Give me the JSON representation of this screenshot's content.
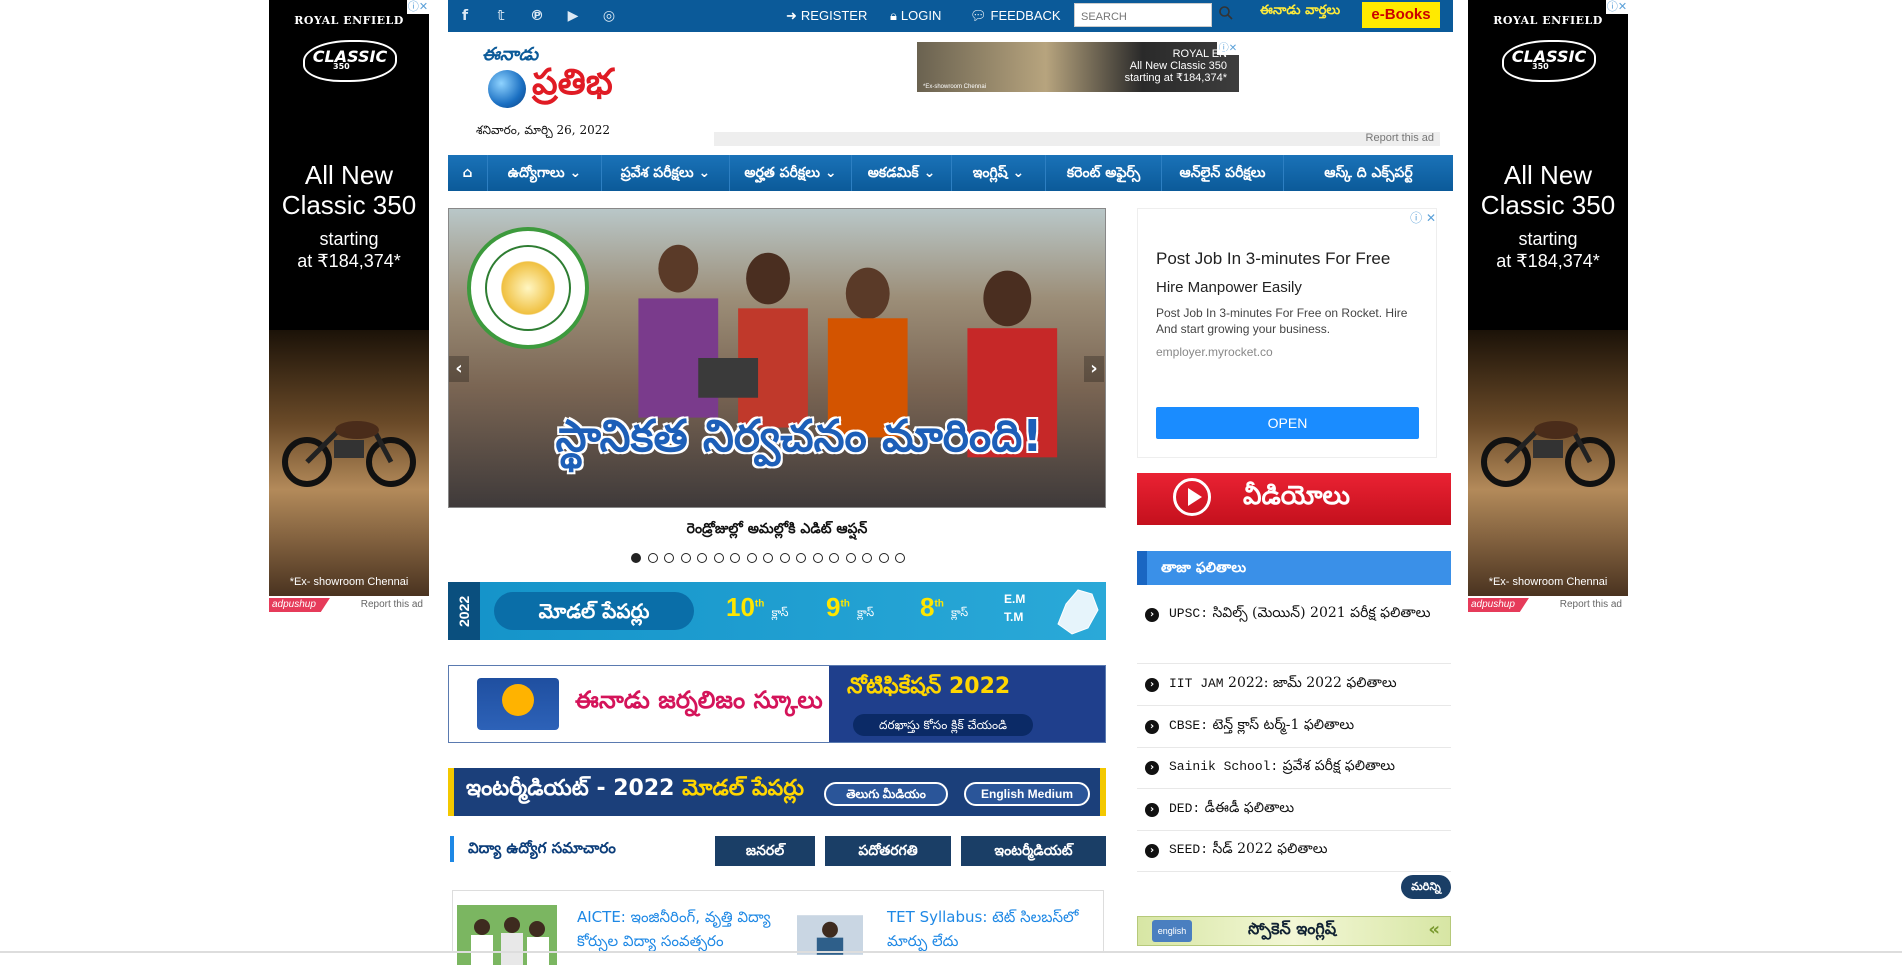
{
  "side_ad": {
    "brand": "ROYAL ENFIELD",
    "logo": "CLASSIC",
    "logo_sub": "350",
    "headline_1": "All New",
    "headline_2": "Classic 350",
    "sub_1": "starting",
    "sub_2": "at ₹184,374*",
    "footnote": "*Ex- showroom Chennai",
    "adpushup": "adpushup",
    "report": "Report this ad"
  },
  "topbar": {
    "social_icons": [
      "facebook-icon",
      "twitter-icon",
      "pinterest-icon",
      "youtube-icon",
      "instagram-icon"
    ],
    "register": "REGISTER",
    "login": "LOGIN",
    "feedback": "FEEDBACK",
    "search_placeholder": "SEARCH",
    "eenadu_news": "ఈనాడు వార్తలు",
    "ebooks": "e-Books"
  },
  "logo": {
    "line1": "ఈనాడు",
    "line2": "ప్రతిభ"
  },
  "date": "శనివారం, మార్చి 26, 2022",
  "top_ad": {
    "brand": "ROYAL EN",
    "line1": "All New Classic 350",
    "line2": "starting at ₹184,374*",
    "footnote": "*Ex-showroom Chennai"
  },
  "report_ad": "Report this ad",
  "nav": {
    "home_icon": "home-icon",
    "items": [
      "ఉద్యోగాలు ⌄",
      "ప్రవేశ పరీక్షలు ⌄",
      "అర్హత పరీక్షలు ⌄",
      "అకడమిక్ ⌄",
      "ఇంగ్లిష్ ⌄",
      "కరెంట్ అఫైర్స్",
      "ఆన్‌లైన్ పరీక్షలు",
      "ఆస్క్ ది ఎక్స్‌పర్ట్"
    ]
  },
  "slider": {
    "headline": "స్థానికత నిర్వచనం మారింది!",
    "caption": "రెండ్రోజుల్లో అమల్లోకి ఎడిట్ ఆప్షన్",
    "dot_count": 17,
    "active_dot": 0
  },
  "banners": {
    "model_papers": {
      "year": "2022",
      "title": "మోడల్ పేపర్లు",
      "classes": [
        {
          "num": "10",
          "sup": "th",
          "label": "క్లాస్"
        },
        {
          "num": "9",
          "sup": "th",
          "label": "క్లాస్"
        },
        {
          "num": "8",
          "sup": "th",
          "label": "క్లాస్"
        }
      ],
      "medium_1": "E.M",
      "medium_2": "T.M"
    },
    "journalism": {
      "title": "ఈనాడు జర్నలిజం స్కూలు",
      "notification": "నోటిఫికేషన్ 2022",
      "cta": "దరఖాస్తు కోసం క్లిక్ చేయండి"
    },
    "inter": {
      "title_a": "ఇంటర్మీడియట్ - 2022",
      "title_b": "మోడల్ పేపర్లు",
      "btn_te": "తెలుగు మీడియం",
      "btn_en": "English Medium"
    }
  },
  "news_section": {
    "heading": "విద్యా ఉద్యోగ సమాచారం",
    "tabs": [
      "జనరల్",
      "పదోతరగతి",
      "ఇంటర్మీడియట్"
    ],
    "items": [
      {
        "title": "AICTE: ఇంజినీరింగ్, వృత్తి విద్యా కోర్సుల విద్యా సంవత్సరం"
      },
      {
        "title": "TET Syllabus: టెట్ సిలబస్‌లో మార్పు లేదు"
      }
    ]
  },
  "right_ad": {
    "headline": "Post Job In 3-minutes For Free",
    "subhead": "Hire Manpower Easily",
    "desc": "Post Job In 3-minutes For Free on Rocket. Hire And start growing your business.",
    "url": "employer.myrocket.co",
    "open": "OPEN"
  },
  "videos": {
    "label": "వీడియోలు"
  },
  "latest_results": {
    "heading": "తాజా ఫలితాలు",
    "items": [
      {
        "en": "UPSC:",
        "te": " సివిల్స్ (మెయిన్) 2021 పరీక్ష ఫలితాలు"
      },
      {
        "en": "IIT JAM",
        "te": " 2022: జామ్ 2022 ఫలితాలు"
      },
      {
        "en": "CBSE:",
        "te": " టెన్త్ క్లాస్ టర్మ్-1 ఫలితాలు"
      },
      {
        "en": "Sainik School:",
        "te": " ప్రవేశ పరీక్ష ఫలితాలు"
      },
      {
        "en": "DED:",
        "te": " డీఈడీ ఫలితాలు"
      },
      {
        "en": "SEED:",
        "te": " సీడ్ 2022 ఫలితాలు"
      }
    ],
    "more": "మరిన్ని"
  },
  "spoken_english": {
    "label": "స్పోకెన్ ఇంగ్లిష్",
    "badge": "english"
  },
  "colors": {
    "primary_blue": "#0b5a99",
    "accent_red": "#e01b24",
    "ebooks_yellow": "#ffea00",
    "link_blue": "#1e88e5"
  }
}
